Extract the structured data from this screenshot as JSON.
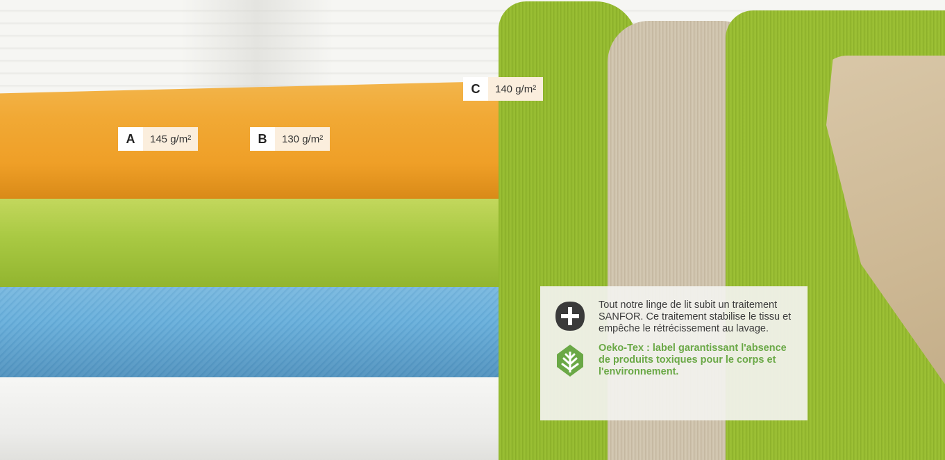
{
  "labels": [
    {
      "letter": "A",
      "weight": "145 g/m²"
    },
    {
      "letter": "B",
      "weight": "130 g/m²"
    },
    {
      "letter": "C",
      "weight": "140 g/m²"
    }
  ],
  "info": {
    "sanfor_icon": "plus-circle-icon",
    "sanfor_text": "Tout notre linge de lit subit un traitement SANFOR. Ce traitement stabilise le tissu et empêche le rétrécissement au lavage.",
    "oekotex_icon": "leaf-icon",
    "oekotex_text": "Oeko-Tex : label garantissant l'absence de produits toxiques pour le corps et l'environnement."
  },
  "colors": {
    "oekotex_green": "#6aa846",
    "icon_dark": "#3a3a3a",
    "label_bg": "#fbeedd"
  }
}
